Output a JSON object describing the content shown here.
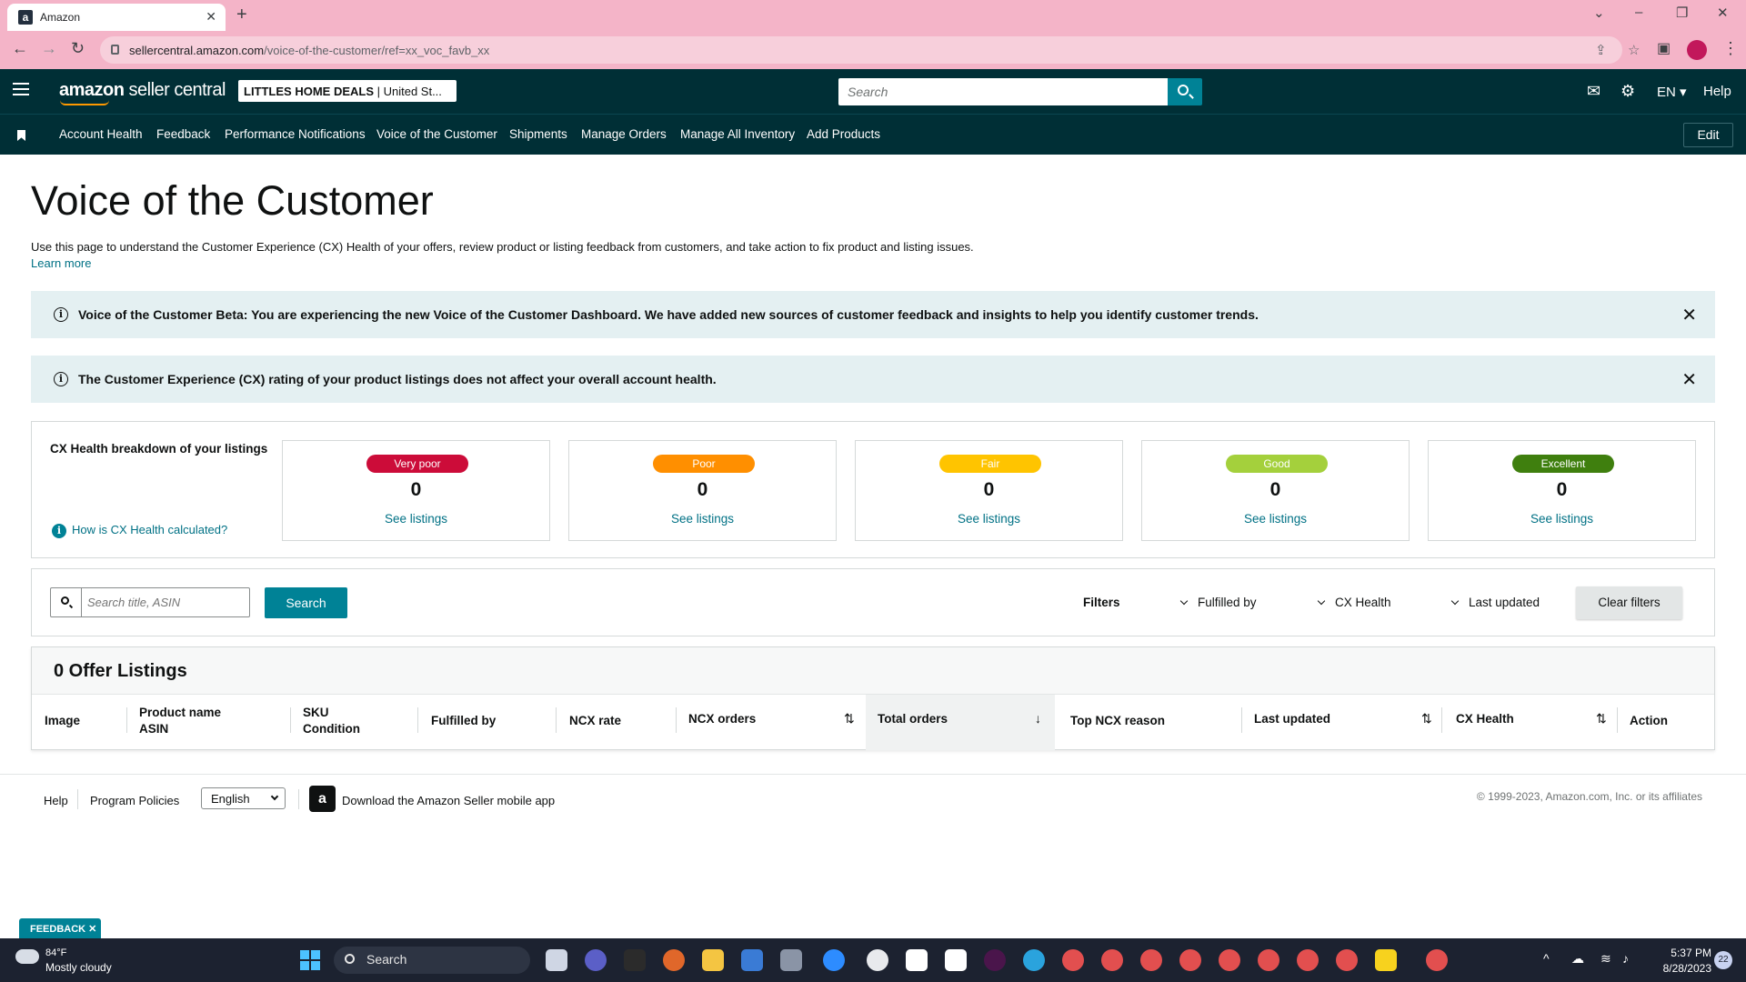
{
  "browser": {
    "tab_title": "Amazon",
    "favicon_letter": "a",
    "url_domain": "sellercentral.amazon.com",
    "url_path": "/voice-of-the-customer/ref=xx_voc_favb_xx"
  },
  "header": {
    "logo_bold": "amazon",
    "logo_light": " seller central",
    "store_name": "LITTLES HOME DEALS",
    "store_region": " | United St...",
    "search_placeholder": "Search",
    "language": "EN",
    "help": "Help"
  },
  "nav": {
    "items": [
      "Account Health",
      "Feedback",
      "Performance Notifications",
      "Voice of the Customer",
      "Shipments",
      "Manage Orders",
      "Manage All Inventory",
      "Add Products"
    ],
    "edit": "Edit"
  },
  "page": {
    "title": "Voice of the Customer",
    "intro": "Use this page to understand the Customer Experience (CX) Health of your offers, review product or listing feedback from customers, and take action to fix product and listing issues.",
    "learn_more": "Learn more"
  },
  "alerts": [
    "Voice of the Customer Beta: You are experiencing the new Voice of the Customer Dashboard. We have added new sources of customer feedback and insights to help you identify customer trends.",
    "The Customer Experience (CX) rating of your product listings does not affect your overall account health."
  ],
  "cx_health": {
    "title": "CX Health breakdown of your listings",
    "help_link": "How is CX Health calculated?",
    "cards": [
      {
        "label": "Very poor",
        "count": "0",
        "link": "See listings",
        "color": "#cc0c39",
        "text_color": "#ffffff"
      },
      {
        "label": "Poor",
        "count": "0",
        "link": "See listings",
        "color": "#ff8f00",
        "text_color": "#ffffff"
      },
      {
        "label": "Fair",
        "count": "0",
        "link": "See listings",
        "color": "#ffc400",
        "text_color": "#ffffff"
      },
      {
        "label": "Good",
        "count": "0",
        "link": "See listings",
        "color": "#a4d03c",
        "text_color": "#ffffff"
      },
      {
        "label": "Excellent",
        "count": "0",
        "link": "See listings",
        "color": "#3f7f0e",
        "text_color": "#ffffff"
      }
    ]
  },
  "filters": {
    "search_placeholder": "Search title, ASIN",
    "search_button": "Search",
    "label": "Filters",
    "fulfilled_by": "Fulfilled by",
    "cx_health": "CX Health",
    "last_updated": "Last updated",
    "clear": "Clear filters"
  },
  "listings": {
    "title": "0 Offer Listings",
    "columns": {
      "image": "Image",
      "product_name": "Product name",
      "asin": "ASIN",
      "sku": "SKU",
      "condition": "Condition",
      "fulfilled_by": "Fulfilled by",
      "ncx_rate": "NCX rate",
      "ncx_orders": "NCX orders",
      "total_orders": "Total orders",
      "top_ncx_reason": "Top NCX reason",
      "last_updated": "Last updated",
      "cx_health": "CX Health",
      "action": "Action"
    }
  },
  "footer": {
    "help": "Help",
    "program_policies": "Program Policies",
    "language": "English",
    "download_app": "Download the Amazon Seller mobile app",
    "copyright": "© 1999-2023, Amazon.com, Inc. or its affiliates"
  },
  "feedback_tab": "FEEDBACK ✕",
  "taskbar": {
    "temperature": "84°F",
    "weather": "Mostly cloudy",
    "search": "Search",
    "time": "5:37 PM",
    "date": "8/28/2023",
    "notifications": "22"
  }
}
